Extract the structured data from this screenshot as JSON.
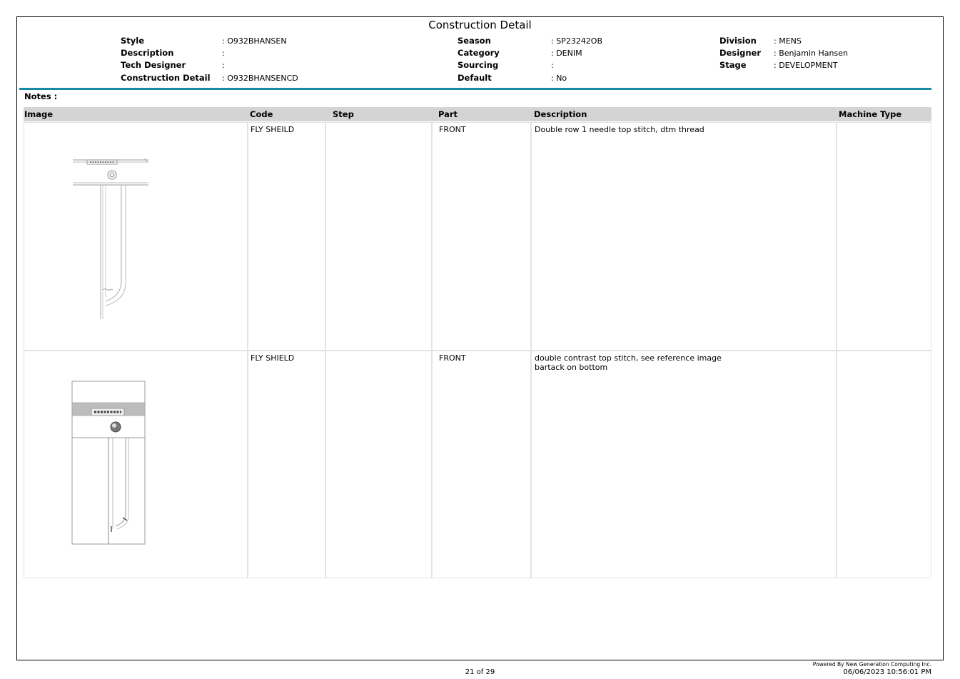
{
  "page": {
    "title": "Construction Detail"
  },
  "header": {
    "style_label": "Style",
    "style_value": ": O932BHANSEN",
    "description_label": "Description",
    "description_value": ":",
    "tech_designer_label": "Tech Designer",
    "tech_designer_value": ":",
    "construction_detail_label": "Construction Detail",
    "construction_detail_value": ": O932BHANSENCD",
    "season_label": "Season",
    "season_value": ":  SP23242OB",
    "category_label": "Category",
    "category_value": ":  DENIM",
    "sourcing_label": "Sourcing",
    "sourcing_value": ":",
    "default_label": "Default",
    "default_value": ":  No",
    "division_label": "Division",
    "division_value": ": MENS",
    "designer_label": "Designer",
    "designer_value": ": Benjamin Hansen",
    "stage_label": "Stage",
    "stage_value": ": DEVELOPMENT"
  },
  "notes_label": "Notes :",
  "table": {
    "columns": [
      "Image",
      "Code",
      "Step",
      "Part",
      "Description",
      "Machine Type"
    ],
    "rows": [
      {
        "code": "FLY SHEILD",
        "step": "",
        "part": "FRONT",
        "description": "Double row 1 needle top stitch, dtm thread",
        "description_line2": "",
        "machine_type": "",
        "image_icon": "fly-shield-flat-sketch"
      },
      {
        "code": "FLY SHIELD",
        "step": "",
        "part": "FRONT",
        "description": "double contrast top stitch, see reference image",
        "description_line2": "bartack on bottom",
        "machine_type": "",
        "image_icon": "fly-shield-reference-sketch"
      }
    ]
  },
  "footer": {
    "page": "21 of 29",
    "powered_by": "Powered By New Generation Computing Inc.",
    "datetime": "06/06/2023 10:56:01 PM"
  }
}
